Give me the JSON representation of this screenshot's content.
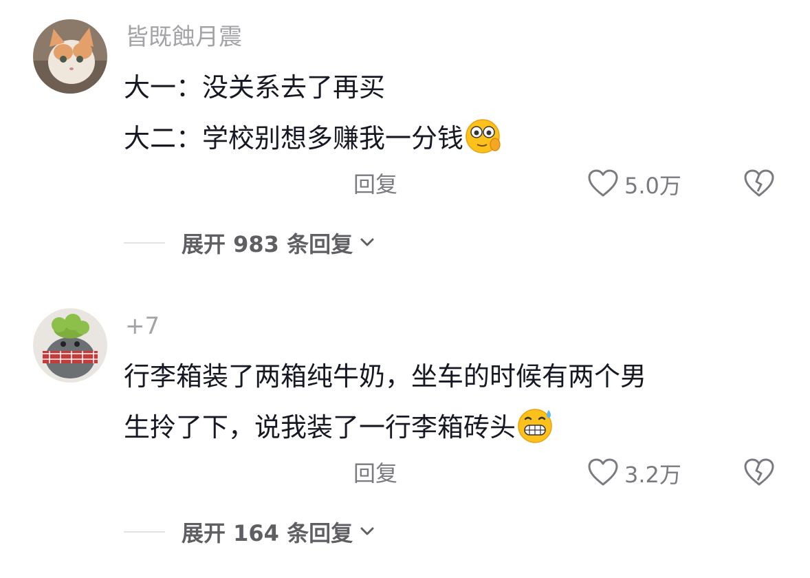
{
  "comments": [
    {
      "username": "皆既蝕月震",
      "lines": [
        "大一：没关系去了再买",
        "大二：学校别想多赚我一分钱"
      ],
      "emoji": "peeking-emoji",
      "reply_label": "回复",
      "likes": "5.0万",
      "expand_label": "展开 983 条回复"
    },
    {
      "username": "+7",
      "lines": [
        "行李箱装了两箱纯牛奶，坐车的时候有两个男",
        "生拎了下，说我装了一行李箱砖头"
      ],
      "emoji": "grin-sweat-emoji",
      "reply_label": "回复",
      "likes": "3.2万",
      "expand_label": "展开 164 条回复"
    }
  ],
  "colors": {
    "text": "#161823",
    "muted": "#7a7a80",
    "username": "#a3a3a8",
    "divider": "#e2e2e5"
  }
}
